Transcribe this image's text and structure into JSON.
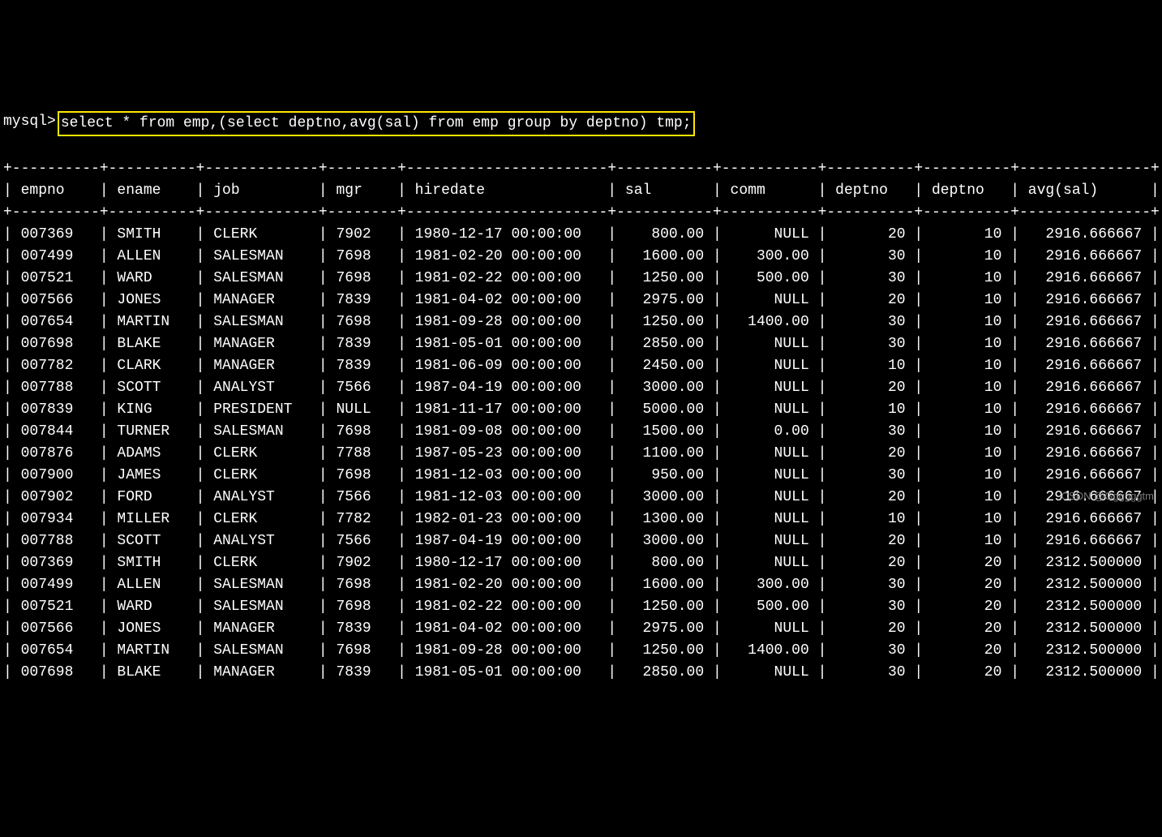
{
  "prompt": "mysql>",
  "query": "select * from emp,(select deptno,avg(sal) from emp group by deptno) tmp;",
  "columns": [
    "empno",
    "ename",
    "job",
    "mgr",
    "hiredate",
    "sal",
    "comm",
    "deptno",
    "deptno",
    "avg(sal)"
  ],
  "widths": [
    8,
    8,
    11,
    6,
    21,
    9,
    9,
    8,
    8,
    13
  ],
  "aligns": [
    "left",
    "left",
    "left",
    "left",
    "left",
    "right",
    "right",
    "right",
    "right",
    "right"
  ],
  "rows": [
    [
      "007369",
      "SMITH",
      "CLERK",
      "7902",
      "1980-12-17 00:00:00",
      "800.00",
      "NULL",
      "20",
      "10",
      "2916.666667"
    ],
    [
      "007499",
      "ALLEN",
      "SALESMAN",
      "7698",
      "1981-02-20 00:00:00",
      "1600.00",
      "300.00",
      "30",
      "10",
      "2916.666667"
    ],
    [
      "007521",
      "WARD",
      "SALESMAN",
      "7698",
      "1981-02-22 00:00:00",
      "1250.00",
      "500.00",
      "30",
      "10",
      "2916.666667"
    ],
    [
      "007566",
      "JONES",
      "MANAGER",
      "7839",
      "1981-04-02 00:00:00",
      "2975.00",
      "NULL",
      "20",
      "10",
      "2916.666667"
    ],
    [
      "007654",
      "MARTIN",
      "SALESMAN",
      "7698",
      "1981-09-28 00:00:00",
      "1250.00",
      "1400.00",
      "30",
      "10",
      "2916.666667"
    ],
    [
      "007698",
      "BLAKE",
      "MANAGER",
      "7839",
      "1981-05-01 00:00:00",
      "2850.00",
      "NULL",
      "30",
      "10",
      "2916.666667"
    ],
    [
      "007782",
      "CLARK",
      "MANAGER",
      "7839",
      "1981-06-09 00:00:00",
      "2450.00",
      "NULL",
      "10",
      "10",
      "2916.666667"
    ],
    [
      "007788",
      "SCOTT",
      "ANALYST",
      "7566",
      "1987-04-19 00:00:00",
      "3000.00",
      "NULL",
      "20",
      "10",
      "2916.666667"
    ],
    [
      "007839",
      "KING",
      "PRESIDENT",
      "NULL",
      "1981-11-17 00:00:00",
      "5000.00",
      "NULL",
      "10",
      "10",
      "2916.666667"
    ],
    [
      "007844",
      "TURNER",
      "SALESMAN",
      "7698",
      "1981-09-08 00:00:00",
      "1500.00",
      "0.00",
      "30",
      "10",
      "2916.666667"
    ],
    [
      "007876",
      "ADAMS",
      "CLERK",
      "7788",
      "1987-05-23 00:00:00",
      "1100.00",
      "NULL",
      "20",
      "10",
      "2916.666667"
    ],
    [
      "007900",
      "JAMES",
      "CLERK",
      "7698",
      "1981-12-03 00:00:00",
      "950.00",
      "NULL",
      "30",
      "10",
      "2916.666667"
    ],
    [
      "007902",
      "FORD",
      "ANALYST",
      "7566",
      "1981-12-03 00:00:00",
      "3000.00",
      "NULL",
      "20",
      "10",
      "2916.666667"
    ],
    [
      "007934",
      "MILLER",
      "CLERK",
      "7782",
      "1982-01-23 00:00:00",
      "1300.00",
      "NULL",
      "10",
      "10",
      "2916.666667"
    ],
    [
      "007788",
      "SCOTT",
      "ANALYST",
      "7566",
      "1987-04-19 00:00:00",
      "3000.00",
      "NULL",
      "20",
      "10",
      "2916.666667"
    ],
    [
      "007369",
      "SMITH",
      "CLERK",
      "7902",
      "1980-12-17 00:00:00",
      "800.00",
      "NULL",
      "20",
      "20",
      "2312.500000"
    ],
    [
      "007499",
      "ALLEN",
      "SALESMAN",
      "7698",
      "1981-02-20 00:00:00",
      "1600.00",
      "300.00",
      "30",
      "20",
      "2312.500000"
    ],
    [
      "007521",
      "WARD",
      "SALESMAN",
      "7698",
      "1981-02-22 00:00:00",
      "1250.00",
      "500.00",
      "30",
      "20",
      "2312.500000"
    ],
    [
      "007566",
      "JONES",
      "MANAGER",
      "7839",
      "1981-04-02 00:00:00",
      "2975.00",
      "NULL",
      "20",
      "20",
      "2312.500000"
    ],
    [
      "007654",
      "MARTIN",
      "SALESMAN",
      "7698",
      "1981-09-28 00:00:00",
      "1250.00",
      "1400.00",
      "30",
      "20",
      "2312.500000"
    ],
    [
      "007698",
      "BLAKE",
      "MANAGER",
      "7839",
      "1981-05-01 00:00:00",
      "2850.00",
      "NULL",
      "30",
      "20",
      "2312.500000"
    ]
  ],
  "watermark": "CSDN @Ggggggtm"
}
